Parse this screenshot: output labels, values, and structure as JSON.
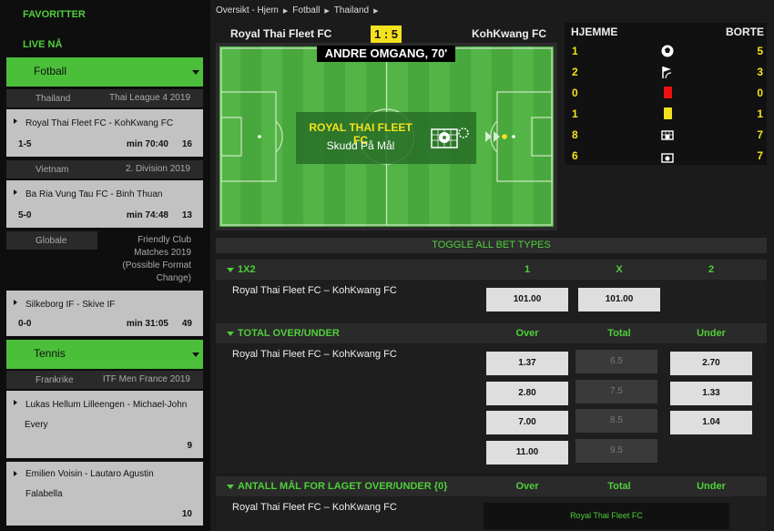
{
  "sidebar": {
    "favorites": "FAVORITTER",
    "live": "LIVE NÅ",
    "sports": [
      {
        "label": "Fotball"
      },
      {
        "label": "Tennis"
      }
    ],
    "football": {
      "cat1": {
        "country": "Thailand",
        "league": "Thai League 4 2019"
      },
      "match1": {
        "title": "Royal Thai Fleet FC - KohKwang FC",
        "score": "1-5",
        "minute": "min 70:40",
        "count": "16"
      },
      "cat2": {
        "country": "Vietnam",
        "league": "2. Division 2019"
      },
      "match2": {
        "title": "Ba Ria Vung Tau FC - Binh Thuan",
        "score": "5-0",
        "minute": "min 74:48",
        "count": "13"
      },
      "cat3": {
        "country": "Globale",
        "league_lines": [
          "Friendly Club",
          "Matches 2019",
          "(Possible Format",
          "Change)"
        ]
      },
      "match3": {
        "title": "Silkeborg IF - Skive IF",
        "score": "0-0",
        "minute": "min 31:05",
        "count": "49"
      }
    },
    "tennis": {
      "cat1": {
        "country": "Frankrike",
        "league": "ITF Men France 2019"
      },
      "match1": {
        "title_lines": [
          "Lukas Hellum Lilleengen - Michael-John",
          "Every"
        ],
        "count": "9"
      },
      "match2": {
        "title_lines": [
          "Emilien Voisin - Lautaro Agustin",
          "Falabella"
        ],
        "count": "10"
      }
    }
  },
  "breadcrumb": [
    "Oversikt - Hjem",
    "Fotball",
    "Thailand"
  ],
  "match": {
    "home": "Royal Thai Fleet FC",
    "away": "KohKwang FC",
    "score": "1 : 5",
    "period": "ANDRE OMGANG, 70'",
    "event_team": "ROYAL THAI FLEET FC",
    "event_text": "Skudd På Mål"
  },
  "stats": {
    "home_label": "HJEMME",
    "away_label": "BORTE",
    "rows": [
      {
        "icon": "goal-ball-icon",
        "home": "1",
        "away": "5"
      },
      {
        "icon": "corner-flag-icon",
        "home": "2",
        "away": "3"
      },
      {
        "icon": "red-card-icon",
        "home": "0",
        "away": "0"
      },
      {
        "icon": "yellow-card-icon",
        "home": "1",
        "away": "1"
      },
      {
        "icon": "shots-on-goal-icon",
        "home": "8",
        "away": "7"
      },
      {
        "icon": "shots-off-goal-icon",
        "home": "6",
        "away": "7"
      }
    ]
  },
  "betting": {
    "toggle": "TOGGLE ALL BET TYPES",
    "m1x2": {
      "name": "1X2",
      "cols": [
        "1",
        "X",
        "2"
      ],
      "event": "Royal Thai Fleet FC – KohKwang FC",
      "odds": [
        "101.00",
        "101.00"
      ]
    },
    "total": {
      "name": "TOTAL OVER/UNDER",
      "cols": [
        "Over",
        "Total",
        "Under"
      ],
      "event": "Royal Thai Fleet FC – KohKwang FC",
      "rows": [
        {
          "over": "1.37",
          "total": "6.5",
          "under": "2.70"
        },
        {
          "over": "2.80",
          "total": "7.5",
          "under": "1.33"
        },
        {
          "over": "7.00",
          "total": "8.5",
          "under": "1.04"
        },
        {
          "over": "11.00",
          "total": "9.5",
          "under": ""
        }
      ]
    },
    "team_goals": {
      "name": "ANTALL MÅL FOR LAGET OVER/UNDER {0}",
      "cols": [
        "Over",
        "Total",
        "Under"
      ],
      "event": "Royal Thai Fleet FC – KohKwang FC",
      "team": "Royal Thai Fleet FC"
    }
  },
  "colors": {
    "accent": "#4bbf3a",
    "score": "#f5e21e",
    "background": "#1b1b1b"
  }
}
